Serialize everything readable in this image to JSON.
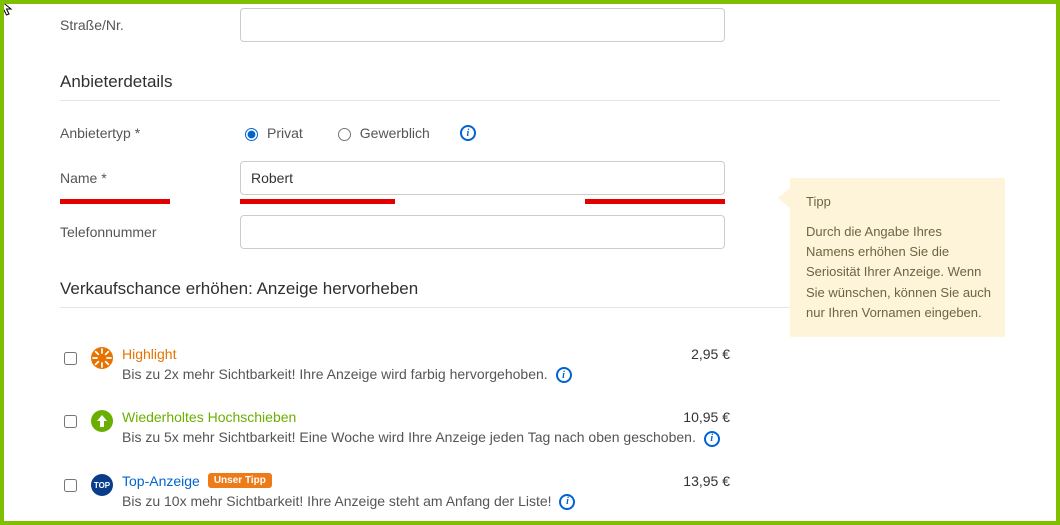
{
  "address": {
    "street_label": "Straße/Nr."
  },
  "provider": {
    "heading": "Anbieterdetails",
    "type_label": "Anbietertyp *",
    "type_private": "Privat",
    "type_commercial": "Gewerblich",
    "name_label": "Name *",
    "name_value": "Robert",
    "phone_label": "Telefonnummer"
  },
  "tip": {
    "title": "Tipp",
    "body": "Durch die Angabe Ihres Namens erhöhen Sie die Seriosität Ihrer Anzeige. Wenn Sie wünschen, können Sie auch nur Ihren Vornamen eingeben."
  },
  "promo": {
    "heading": "Verkaufschance erhöhen: Anzeige hervorheben",
    "items": [
      {
        "title": "Highlight",
        "desc": "Bis zu 2x mehr Sichtbarkeit! Ihre Anzeige wird farbig hervorgehoben.",
        "price": "2,95 €"
      },
      {
        "title": "Wiederholtes Hochschieben",
        "desc": "Bis zu 5x mehr Sichtbarkeit! Eine Woche wird Ihre Anzeige jeden Tag nach oben geschoben.",
        "price": "10,95 €"
      },
      {
        "title": "Top-Anzeige",
        "badge": "Unser Tipp",
        "desc": "Bis zu 10x mehr Sichtbarkeit! Ihre Anzeige steht am Anfang der Liste!",
        "price": "13,95 €"
      }
    ]
  }
}
